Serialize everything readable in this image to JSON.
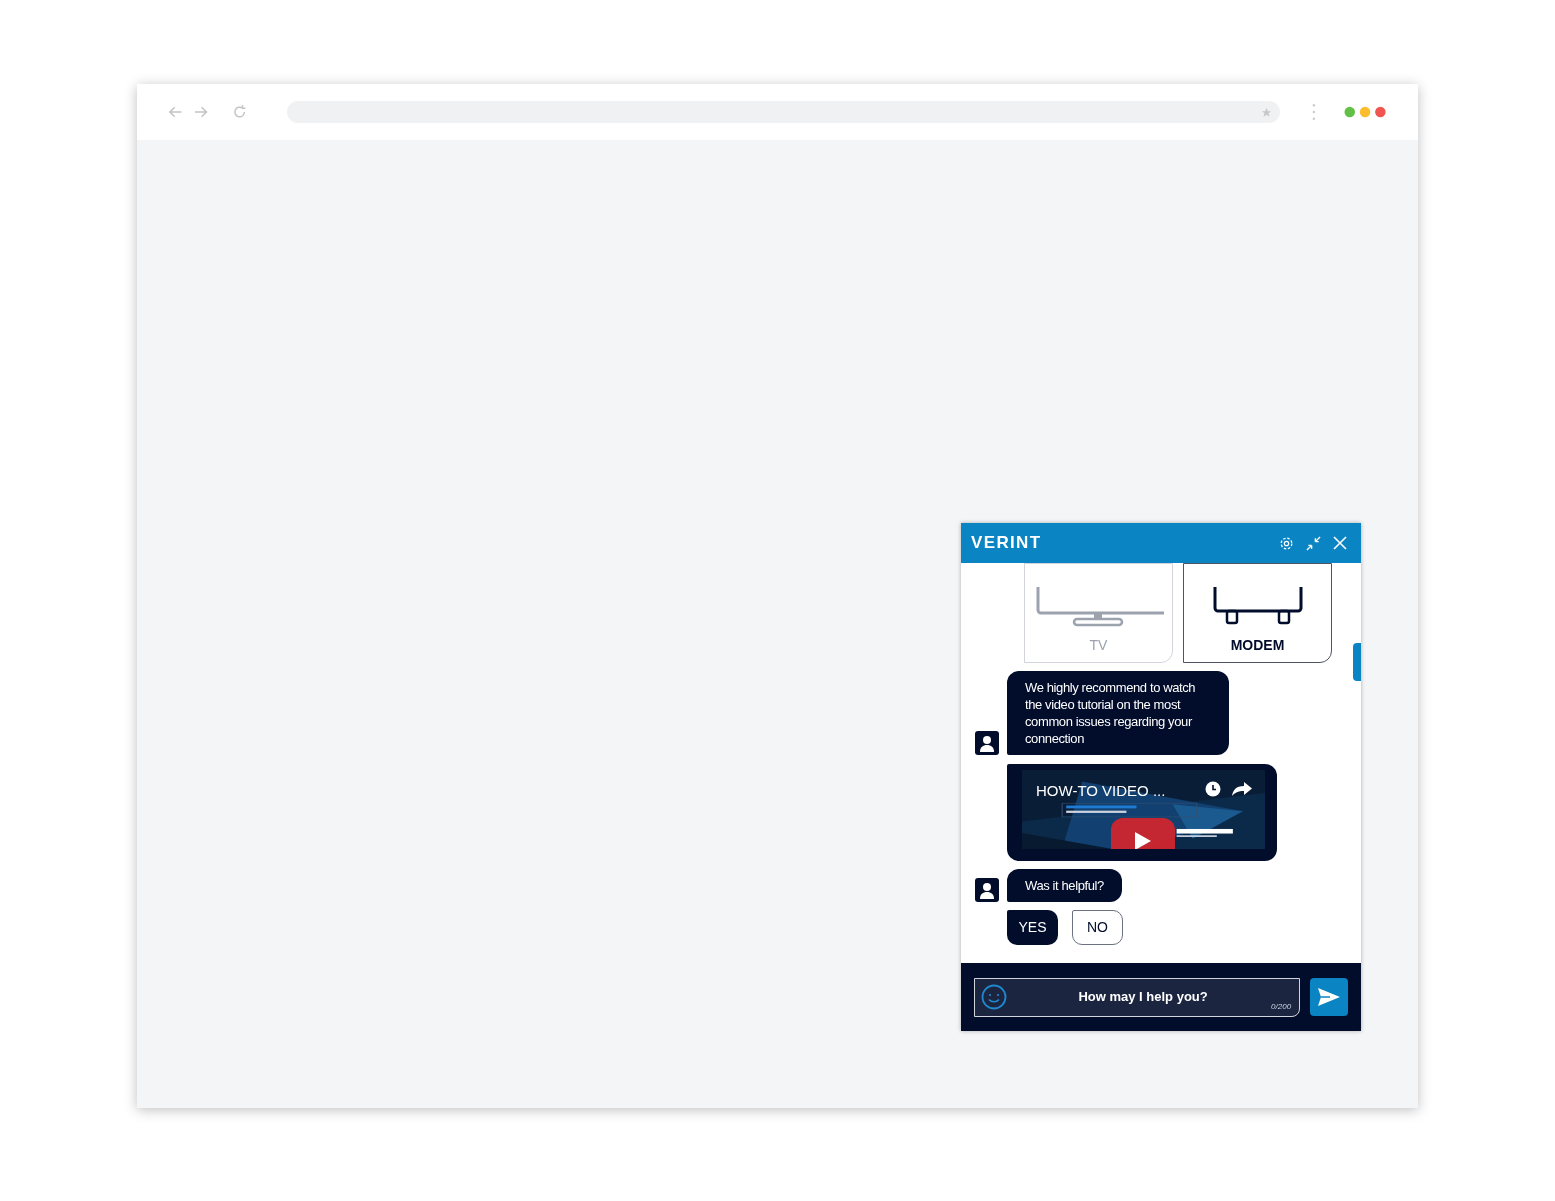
{
  "chat": {
    "title": "VERINT",
    "options": [
      {
        "label": "TV",
        "selected": false
      },
      {
        "label": "MODEM",
        "selected": true
      }
    ],
    "messages": [
      {
        "kind": "text",
        "text": "We highly recommend to watch the video tutorial on the most common issues regarding your connection"
      },
      {
        "kind": "video",
        "title": "HOW-TO VIDEO ..."
      },
      {
        "kind": "text",
        "text": "Was it helpful?"
      }
    ],
    "quick_replies": [
      {
        "label": "YES",
        "selected": true
      },
      {
        "label": "NO",
        "selected": false
      }
    ],
    "input": {
      "placeholder": "How may I help you?",
      "counter": "0/200"
    }
  }
}
